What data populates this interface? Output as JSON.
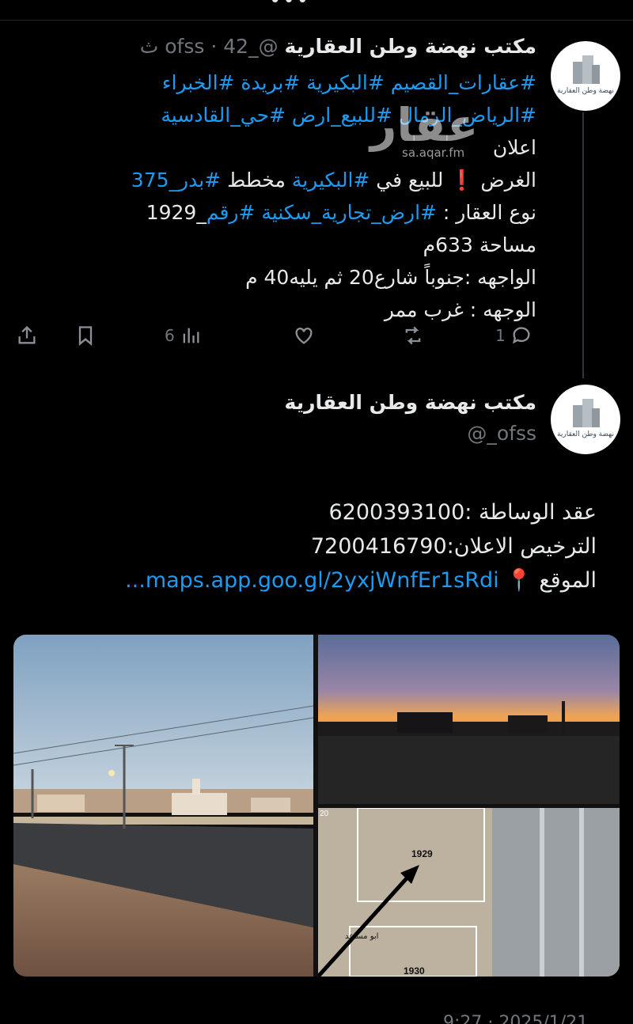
{
  "tweet1": {
    "author_name": "مكتب نهضة وطن العقارية",
    "handle": "@_ofss",
    "separator": "·",
    "time": "42 ث",
    "lines": [
      [
        {
          "t": "#عقارات_القصيم #البكيرية #بريدة #الخبراء",
          "tag": true
        }
      ],
      [
        {
          "t": "#الرياض_الرمال #للبيع_ارض #حي_القادسية",
          "tag": true
        }
      ],
      [
        {
          "t": "اعلان",
          "tag": false
        }
      ],
      [
        {
          "t": "الغرض ❗ للبيع في ",
          "tag": false
        },
        {
          "t": "#البكيرية",
          "tag": true
        },
        {
          "t": " مخطط ",
          "tag": false
        },
        {
          "t": "#بدر_375",
          "tag": true
        }
      ],
      [
        {
          "t": "نوع العقار : ",
          "tag": false
        },
        {
          "t": "#ارض_تجارية_سكنية",
          "tag": true
        },
        {
          "t": "  ",
          "tag": false
        },
        {
          "t": "#رقم",
          "tag": true
        },
        {
          "t": "_1929",
          "tag": false
        }
      ],
      [
        {
          "t": "مساحة 633م",
          "tag": false
        }
      ],
      [
        {
          "t": "الواجهه :جنوباً شارع20 ثم يليه40 م",
          "tag": false
        }
      ],
      [
        {
          "t": "الوجهه : غرب ممر",
          "tag": false
        }
      ]
    ],
    "watermark": "عقار",
    "watermark_sub": "sa.aqar.fm",
    "replies": "1",
    "views": "6"
  },
  "tweet2": {
    "author_name": "مكتب نهضة وطن العقارية",
    "handle": "@_ofss",
    "brokerage": "عقد الوساطة :6200393100",
    "license": "الترخيص الاعلان:7200416790",
    "location_label": "الموقع 📍",
    "location_link": "maps.app.goo.gl/2yxjWnfEr1sRdi..."
  },
  "avatar_text": "نهضة وطن العقارية",
  "map_labels": {
    "plot_a": "1929",
    "plot_b": "1930",
    "street": "ابو مساعد",
    "edge": "20"
  },
  "footer_time": "9:27 · 2025/1/21",
  "colors": {
    "link": "#1d9bf0",
    "background": "#000000",
    "muted": "#71767b"
  }
}
